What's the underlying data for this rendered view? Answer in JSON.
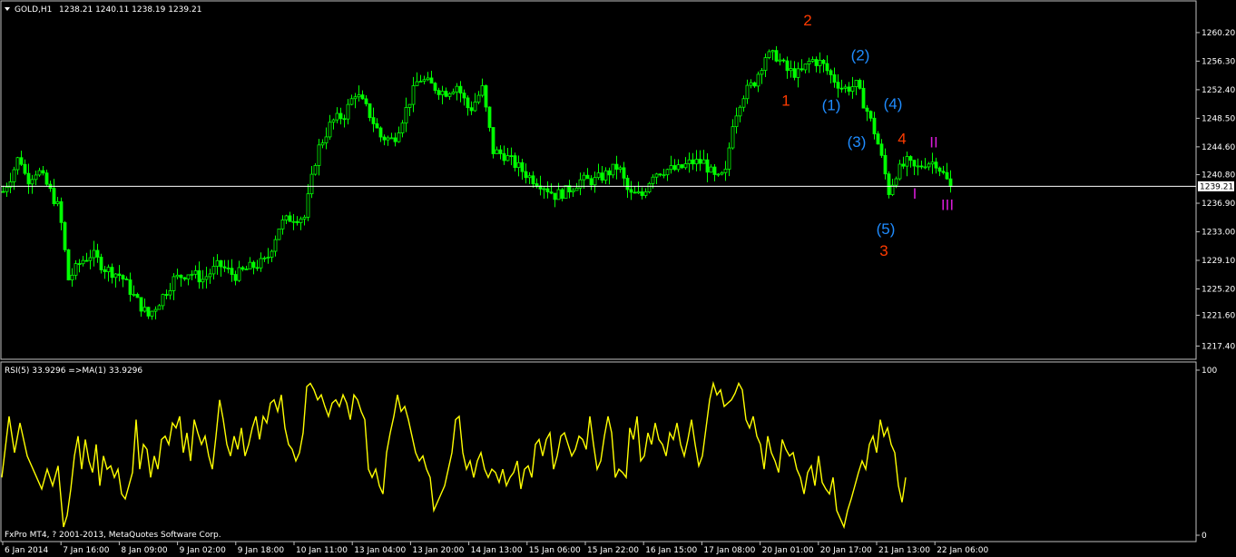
{
  "header": {
    "symbol": "GOLD,H1",
    "ohlc": "1238.21 1240.11 1238.19 1239.21",
    "menu_icon": "triangle-down-icon"
  },
  "indicator": {
    "label": "RSI(5) 33.9296  =>MA(1) 33.9296"
  },
  "footer": {
    "copyright": "FxPro MT4, ? 2001-2013, MetaQuotes Software Corp."
  },
  "colors": {
    "background": "#000000",
    "candle": "#00ff00",
    "rsi": "#ffff00",
    "grid": "#ffffff",
    "wave_red": "#ff3b00",
    "wave_blue": "#1f8cff",
    "wave_magenta": "#d81bd8"
  },
  "chart_data": [
    {
      "type": "candlestick",
      "symbol": "GOLD",
      "timeframe": "H1",
      "current_price": "1239.21",
      "ylim": [
        1215.6,
        1264.4
      ],
      "y_ticks": [
        "1260.20",
        "1256.30",
        "1252.40",
        "1248.50",
        "1244.60",
        "1240.80",
        "1236.90",
        "1233.00",
        "1229.10",
        "1225.20",
        "1221.60",
        "1217.40"
      ],
      "y_tick_values": [
        1260.2,
        1256.3,
        1252.4,
        1248.5,
        1244.6,
        1240.8,
        1236.9,
        1233.0,
        1229.1,
        1225.2,
        1221.6,
        1217.4
      ],
      "x_ticks": [
        "6 Jan 2014",
        "7 Jan 16:00",
        "8 Jan 09:00",
        "9 Jan 02:00",
        "9 Jan 18:00",
        "10 Jan 11:00",
        "13 Jan 04:00",
        "13 Jan 20:00",
        "14 Jan 13:00",
        "15 Jan 06:00",
        "15 Jan 22:00",
        "16 Jan 15:00",
        "17 Jan 08:00",
        "20 Jan 01:00",
        "20 Jan 17:00",
        "21 Jan 13:00",
        "22 Jan 06:00"
      ],
      "anchors": [
        [
          0,
          1238.5
        ],
        [
          10,
          1241
        ],
        [
          18,
          1243.5
        ],
        [
          26,
          1240
        ],
        [
          38,
          1241.5
        ],
        [
          50,
          1239
        ],
        [
          62,
          1236
        ],
        [
          72,
          1226.5
        ],
        [
          86,
          1229
        ],
        [
          98,
          1230
        ],
        [
          112,
          1228
        ],
        [
          130,
          1227
        ],
        [
          145,
          1224
        ],
        [
          160,
          1221.5
        ],
        [
          172,
          1223.5
        ],
        [
          188,
          1226.5
        ],
        [
          205,
          1227.5
        ],
        [
          220,
          1226.5
        ],
        [
          238,
          1228.5
        ],
        [
          255,
          1227
        ],
        [
          270,
          1228
        ],
        [
          290,
          1229
        ],
        [
          305,
          1234
        ],
        [
          318,
          1235
        ],
        [
          332,
          1235
        ],
        [
          346,
          1244
        ],
        [
          362,
          1248
        ],
        [
          376,
          1249
        ],
        [
          388,
          1252
        ],
        [
          402,
          1249.5
        ],
        [
          416,
          1246
        ],
        [
          430,
          1245.5
        ],
        [
          445,
          1250
        ],
        [
          458,
          1254
        ],
        [
          472,
          1253
        ],
        [
          486,
          1252
        ],
        [
          500,
          1253
        ],
        [
          514,
          1249.5
        ],
        [
          528,
          1252.5
        ],
        [
          540,
          1244
        ],
        [
          552,
          1243.5
        ],
        [
          566,
          1242
        ],
        [
          580,
          1240.5
        ],
        [
          594,
          1239.5
        ],
        [
          608,
          1238
        ],
        [
          620,
          1238.5
        ],
        [
          636,
          1240
        ],
        [
          652,
          1240
        ],
        [
          666,
          1241
        ],
        [
          678,
          1242
        ],
        [
          690,
          1238
        ],
        [
          704,
          1238
        ],
        [
          716,
          1241
        ],
        [
          730,
          1241.5
        ],
        [
          744,
          1241.5
        ],
        [
          758,
          1242.5
        ],
        [
          772,
          1242.5
        ],
        [
          786,
          1240
        ],
        [
          796,
          1241
        ],
        [
          804,
          1248
        ],
        [
          814,
          1251.5
        ],
        [
          828,
          1253.5
        ],
        [
          840,
          1257
        ],
        [
          852,
          1257
        ],
        [
          864,
          1255
        ],
        [
          878,
          1254.5
        ],
        [
          890,
          1256.5
        ],
        [
          902,
          1256
        ],
        [
          914,
          1254
        ],
        [
          926,
          1252.5
        ],
        [
          940,
          1253
        ],
        [
          952,
          1249.5
        ],
        [
          962,
          1246
        ],
        [
          970,
          1242
        ],
        [
          976,
          1238.5
        ],
        [
          984,
          1241
        ],
        [
          996,
          1242.5
        ],
        [
          1006,
          1241.5
        ],
        [
          1016,
          1242.5
        ],
        [
          1028,
          1242.5
        ],
        [
          1040,
          1240
        ],
        [
          1046,
          1238.5
        ]
      ],
      "annotations": [
        {
          "text": "2",
          "t": 888,
          "p": 1261.2,
          "color": "wave_red"
        },
        {
          "text": "1",
          "t": 864,
          "p": 1250.2,
          "color": "wave_red"
        },
        {
          "text": "4",
          "t": 992,
          "p": 1245.0,
          "color": "wave_red"
        },
        {
          "text": "3",
          "t": 972,
          "p": 1229.7,
          "color": "wave_red"
        },
        {
          "text": "(2)",
          "t": 946,
          "p": 1256.4,
          "color": "wave_blue"
        },
        {
          "text": "(1)",
          "t": 914,
          "p": 1249.6,
          "color": "wave_blue"
        },
        {
          "text": "(4)",
          "t": 982,
          "p": 1249.8,
          "color": "wave_blue"
        },
        {
          "text": "(3)",
          "t": 942,
          "p": 1244.6,
          "color": "wave_blue"
        },
        {
          "text": "(5)",
          "t": 974,
          "p": 1232.7,
          "color": "wave_blue"
        },
        {
          "text": "II",
          "t": 1027,
          "p": 1244.5,
          "color": "wave_magenta"
        },
        {
          "text": "I",
          "t": 1006,
          "p": 1237.5,
          "color": "wave_magenta"
        },
        {
          "text": "III",
          "t": 1042,
          "p": 1236.0,
          "color": "wave_magenta"
        }
      ]
    },
    {
      "type": "line",
      "name": "RSI(5)",
      "value": 33.9296,
      "ylim": [
        0,
        100
      ],
      "y_ticks": [
        "100",
        "0"
      ],
      "y_tick_values": [
        100,
        0
      ],
      "x": [
        0,
        8,
        14,
        20,
        28,
        36,
        44,
        50,
        56,
        62,
        68,
        72,
        76,
        80,
        84,
        88,
        92,
        96,
        100,
        104,
        108,
        112,
        116,
        120,
        124,
        128,
        132,
        136,
        140,
        144,
        148,
        152,
        156,
        160,
        164,
        168,
        172,
        176,
        180,
        184,
        188,
        192,
        196,
        200,
        204,
        208,
        212,
        216,
        220,
        224,
        228,
        232,
        236,
        240,
        244,
        248,
        252,
        256,
        260,
        264,
        268,
        272,
        276,
        280,
        284,
        288,
        292,
        296,
        300,
        304,
        308,
        312,
        316,
        320,
        324,
        328,
        332,
        336,
        340,
        344,
        348,
        352,
        356,
        360,
        364,
        368,
        372,
        376,
        380,
        384,
        388,
        392,
        396,
        400,
        404,
        408,
        412,
        416,
        420,
        424,
        428,
        432,
        436,
        440,
        444,
        448,
        452,
        456,
        460,
        464,
        468,
        472,
        476,
        480,
        484,
        488,
        492,
        496,
        500,
        504,
        508,
        512,
        516,
        520,
        524,
        528,
        532,
        536,
        540,
        544,
        548,
        552,
        556,
        560,
        564,
        568,
        572,
        576,
        580,
        584,
        588,
        592,
        596,
        600,
        604,
        608,
        612,
        616,
        620,
        624,
        628,
        632,
        636,
        640,
        644,
        648,
        652,
        656,
        660,
        664,
        668,
        672,
        676,
        680,
        684,
        688,
        692,
        696,
        700,
        704,
        708,
        712,
        716,
        720,
        724,
        728,
        732,
        736,
        740,
        744,
        748,
        752,
        756,
        760,
        764,
        768,
        772,
        776,
        780,
        784,
        788,
        792,
        796,
        800,
        804,
        808,
        812,
        816,
        820,
        824,
        828,
        832,
        836,
        840,
        844,
        848,
        852,
        856,
        860,
        864,
        868,
        872,
        876,
        880,
        884,
        888,
        892,
        896,
        900,
        904,
        908,
        912,
        916,
        920,
        924,
        928,
        932,
        936,
        940,
        944,
        948,
        952,
        956,
        960,
        964,
        968,
        972,
        976,
        980,
        984,
        988,
        992,
        996,
        1000,
        1004,
        1008,
        1012,
        1016,
        1020,
        1024,
        1028,
        1032,
        1036,
        1040,
        1044,
        1048
      ],
      "values": [
        35,
        72,
        50,
        68,
        48,
        38,
        28,
        40,
        30,
        42,
        5,
        12,
        28,
        48,
        60,
        40,
        58,
        45,
        38,
        55,
        30,
        48,
        40,
        42,
        35,
        40,
        25,
        22,
        30,
        38,
        70,
        40,
        55,
        52,
        35,
        48,
        40,
        58,
        60,
        55,
        68,
        65,
        72,
        50,
        62,
        45,
        70,
        62,
        55,
        60,
        48,
        40,
        60,
        82,
        70,
        55,
        48,
        60,
        52,
        65,
        48,
        55,
        65,
        72,
        58,
        72,
        68,
        80,
        82,
        75,
        85,
        65,
        55,
        52,
        45,
        50,
        62,
        90,
        92,
        88,
        82,
        85,
        78,
        72,
        80,
        82,
        78,
        85,
        80,
        70,
        85,
        82,
        75,
        70,
        40,
        35,
        40,
        30,
        25,
        50,
        62,
        72,
        85,
        75,
        78,
        70,
        60,
        50,
        45,
        48,
        40,
        35,
        15,
        20,
        25,
        30,
        40,
        50,
        70,
        72,
        50,
        40,
        45,
        35,
        45,
        50,
        40,
        35,
        40,
        38,
        32,
        40,
        30,
        35,
        38,
        45,
        28,
        40,
        42,
        35,
        55,
        58,
        48,
        58,
        62,
        40,
        48,
        60,
        62,
        55,
        48,
        52,
        60,
        58,
        52,
        72,
        55,
        40,
        45,
        60,
        72,
        62,
        35,
        40,
        38,
        35,
        65,
        58,
        72,
        45,
        48,
        62,
        55,
        68,
        58,
        55,
        48,
        62,
        58,
        68,
        55,
        48,
        58,
        70,
        55,
        42,
        48,
        65,
        82,
        92,
        85,
        88,
        78,
        80,
        82,
        86,
        92,
        88,
        70,
        65,
        72,
        60,
        55,
        40,
        60,
        50,
        45,
        38,
        58,
        52,
        48,
        50,
        40,
        35,
        25,
        38,
        42,
        30,
        48,
        32,
        28,
        25,
        35,
        15,
        10,
        5,
        15,
        22,
        30,
        38,
        45,
        40,
        55,
        60,
        50,
        70,
        60,
        65,
        55,
        50,
        30,
        20,
        35
      ]
    }
  ]
}
